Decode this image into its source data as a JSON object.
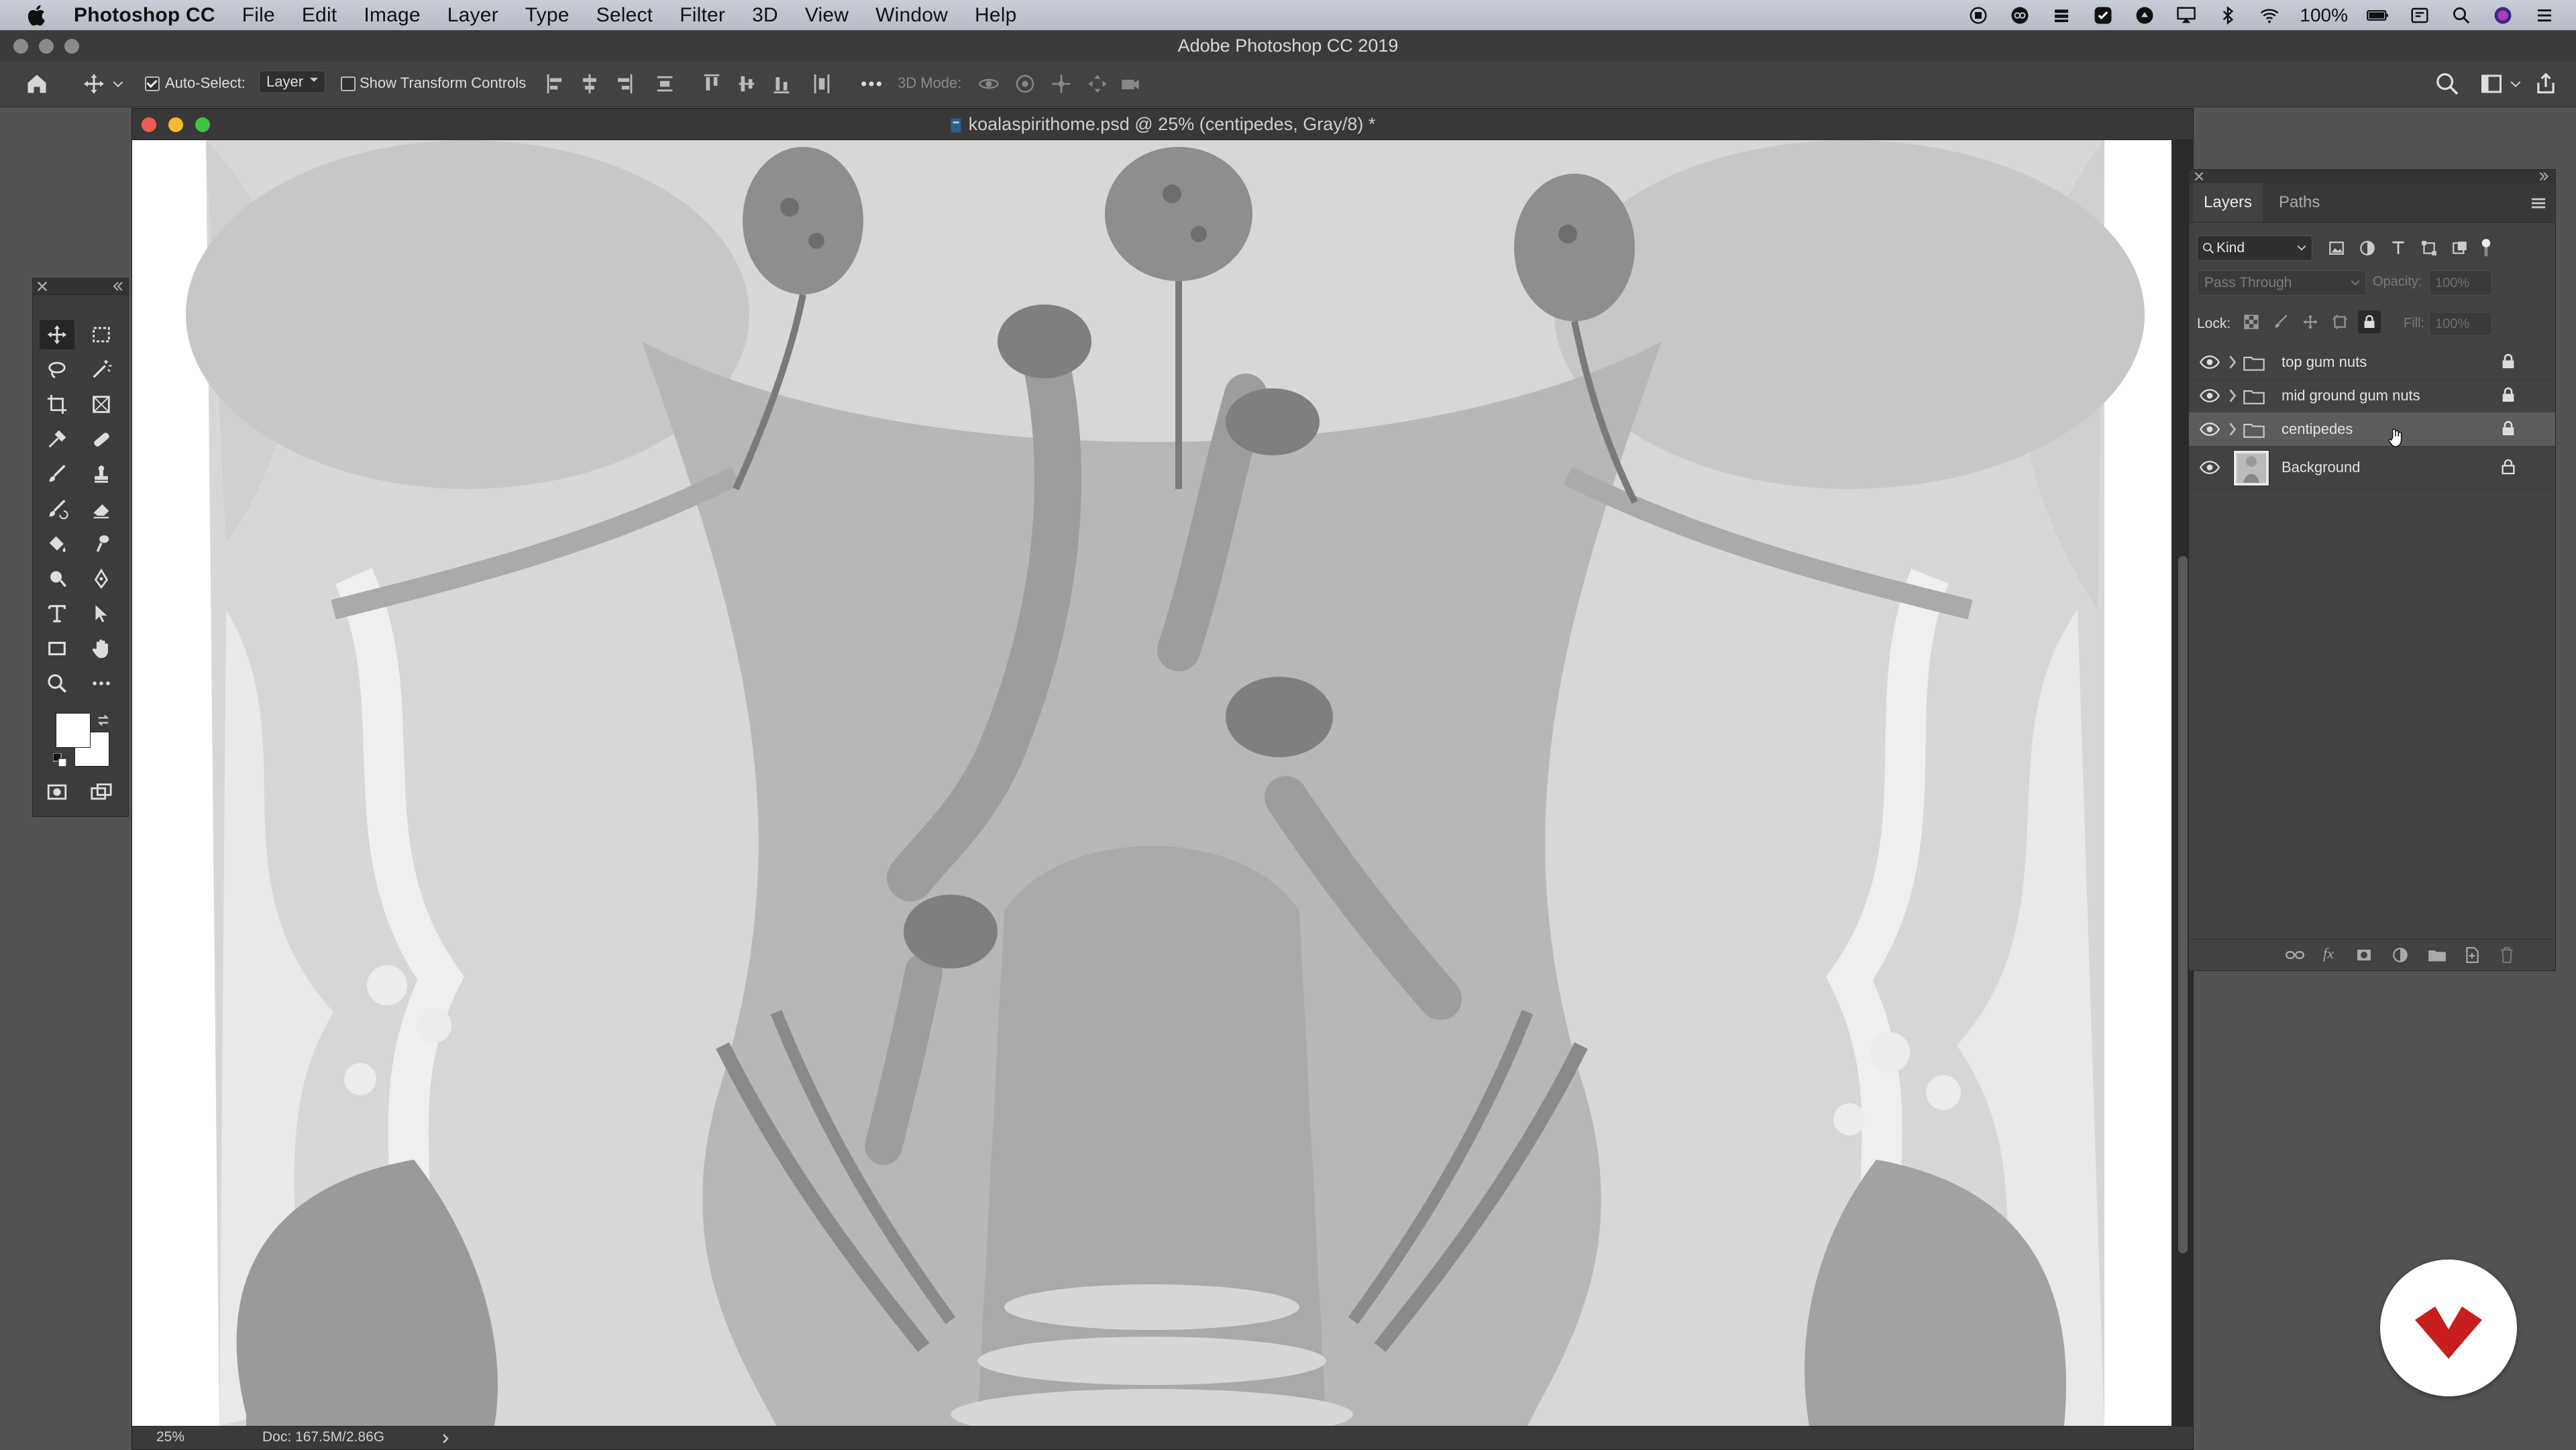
{
  "menubar": {
    "items": [
      "Photoshop CC",
      "File",
      "Edit",
      "Image",
      "Layer",
      "Type",
      "Select",
      "Filter",
      "3D",
      "View",
      "Window",
      "Help"
    ],
    "battery": "100%"
  },
  "app": {
    "title": "Adobe Photoshop CC 2019"
  },
  "options": {
    "auto_select_label": "Auto-Select:",
    "auto_select_value": "Layer",
    "transform_label": "Show Transform Controls",
    "mode_3d_label": "3D Mode:"
  },
  "document": {
    "title": "koalaspirithome.psd @ 25% (centipedes, Gray/8) *",
    "zoom": "25%",
    "doc_size": "Doc: 167.5M/2.86G"
  },
  "layers_panel": {
    "tabs": [
      "Layers",
      "Paths"
    ],
    "filter_value": "Kind",
    "blend_mode": "Pass Through",
    "opacity_label": "Opacity:",
    "opacity_value": "100%",
    "lock_label": "Lock:",
    "fill_label": "Fill:",
    "fill_value": "100%",
    "layers": [
      {
        "name": "top gum nuts",
        "type": "group"
      },
      {
        "name": "mid ground gum nuts",
        "type": "group"
      },
      {
        "name": "centipedes",
        "type": "group",
        "selected": true
      },
      {
        "name": "Background",
        "type": "pixel"
      }
    ]
  },
  "colors": {
    "accent_brand": "#c81e1e",
    "ui_bg": "#535353",
    "panel_bg": "#424242"
  }
}
